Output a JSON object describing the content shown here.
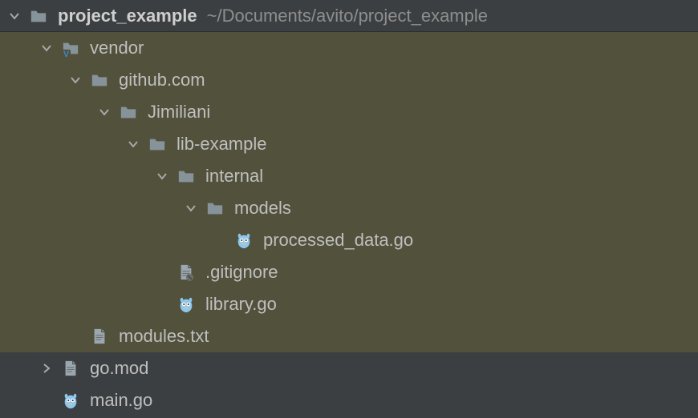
{
  "header": {
    "project_name": "project_example",
    "project_path": "~/Documents/avito/project_example"
  },
  "tree": {
    "vendor": {
      "label": "vendor",
      "github": {
        "label": "github.com",
        "jimiliani": {
          "label": "Jimiliani",
          "lib_example": {
            "label": "lib-example",
            "internal": {
              "label": "internal",
              "models": {
                "label": "models",
                "processed_data": {
                  "label": "processed_data.go"
                }
              }
            },
            "gitignore": {
              "label": ".gitignore"
            },
            "library": {
              "label": "library.go"
            }
          }
        }
      },
      "modules_txt": {
        "label": "modules.txt"
      }
    },
    "go_mod": {
      "label": "go.mod"
    },
    "main_go": {
      "label": "main.go"
    }
  },
  "icons": {
    "chevron_down": "chevron-down-icon",
    "chevron_right": "chevron-right-icon",
    "folder": "folder-icon",
    "folder_vendor": "folder-vendor-icon",
    "go_file": "go-file-icon",
    "text_file": "text-file-icon",
    "gitignore_file": "gitignore-file-icon"
  },
  "colors": {
    "folder": "#87939a",
    "go_accent": "#6fb4e3",
    "text_file": "#9aa7b0",
    "vendor_badge": "#3e86c7",
    "vendor_bg": "#52513c"
  }
}
